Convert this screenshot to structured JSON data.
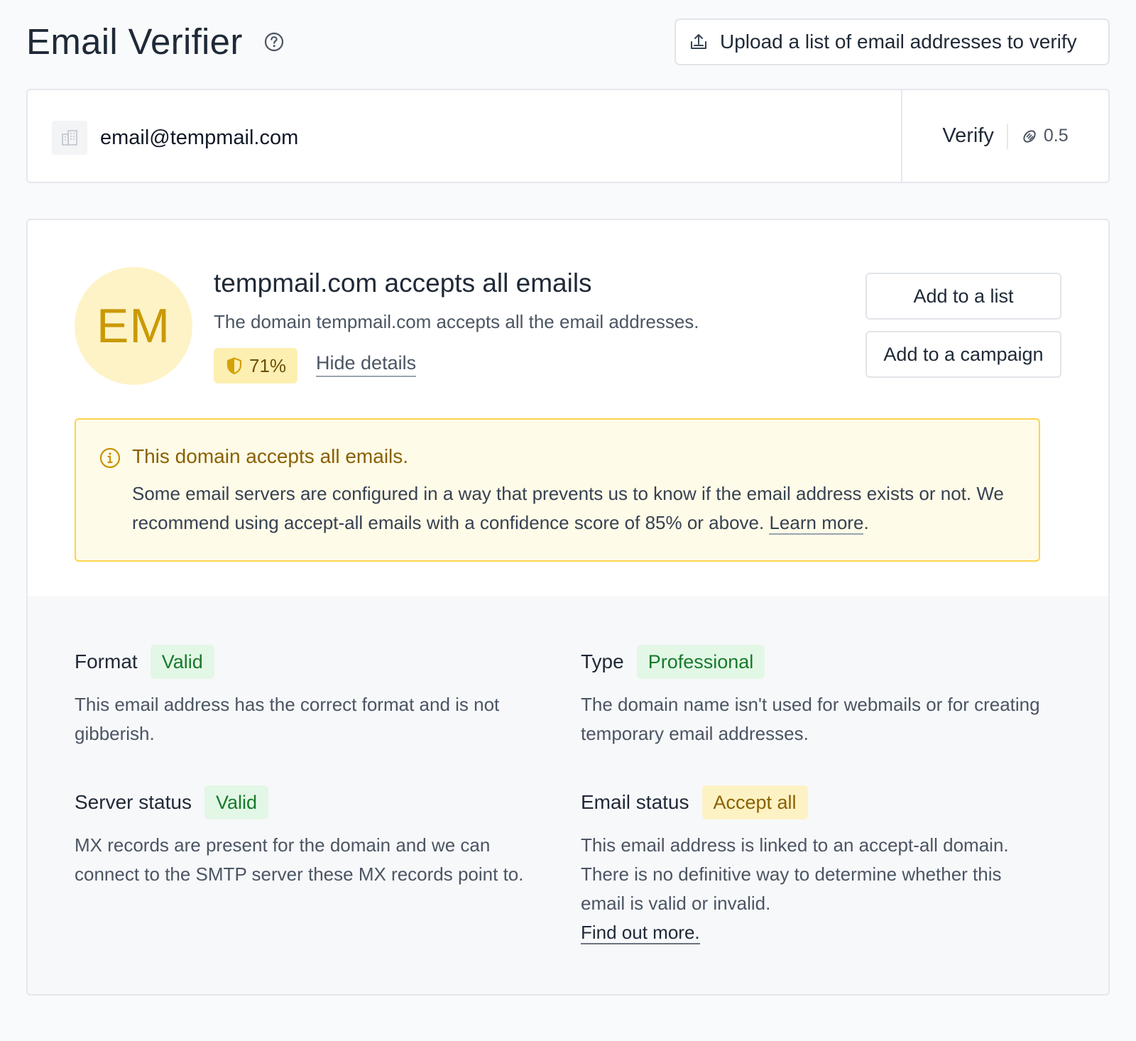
{
  "header": {
    "title": "Email Verifier",
    "upload_label": "Upload a list of email addresses to verify"
  },
  "search": {
    "value": "email@tempmail.com",
    "verify_label": "Verify",
    "credit_cost": "0.5"
  },
  "result": {
    "avatar_initials": "EM",
    "title": "tempmail.com accepts all emails",
    "subtitle": "The domain tempmail.com accepts all the email addresses.",
    "score": "71%",
    "hide_details_label": "Hide details",
    "add_to_list_label": "Add to a list",
    "add_to_campaign_label": "Add to a campaign"
  },
  "alert": {
    "title": "This domain accepts all emails.",
    "body": "Some email servers are configured in a way that prevents us to know if the email address exists or not. We recommend using accept-all emails with a confidence score of 85% or above. ",
    "link": "Learn more",
    "period": "."
  },
  "details": {
    "format": {
      "label": "Format",
      "tag": "Valid",
      "text": "This email address has the correct format and is not gibberish."
    },
    "type": {
      "label": "Type",
      "tag": "Professional",
      "text": "The domain name isn't used for webmails or for creating temporary email addresses."
    },
    "server": {
      "label": "Server status",
      "tag": "Valid",
      "text": "MX records are present for the domain and we can connect to the SMTP server these MX records point to."
    },
    "status": {
      "label": "Email status",
      "tag": "Accept all",
      "text": "This email address is linked to an accept-all domain. There is no definitive way to determine whether this email is valid or invalid.",
      "link": "Find out more."
    }
  },
  "colors": {
    "accent_yellow": "#ca9a04",
    "valid_green": "#177a2c",
    "alert_border": "#fcd34d"
  }
}
